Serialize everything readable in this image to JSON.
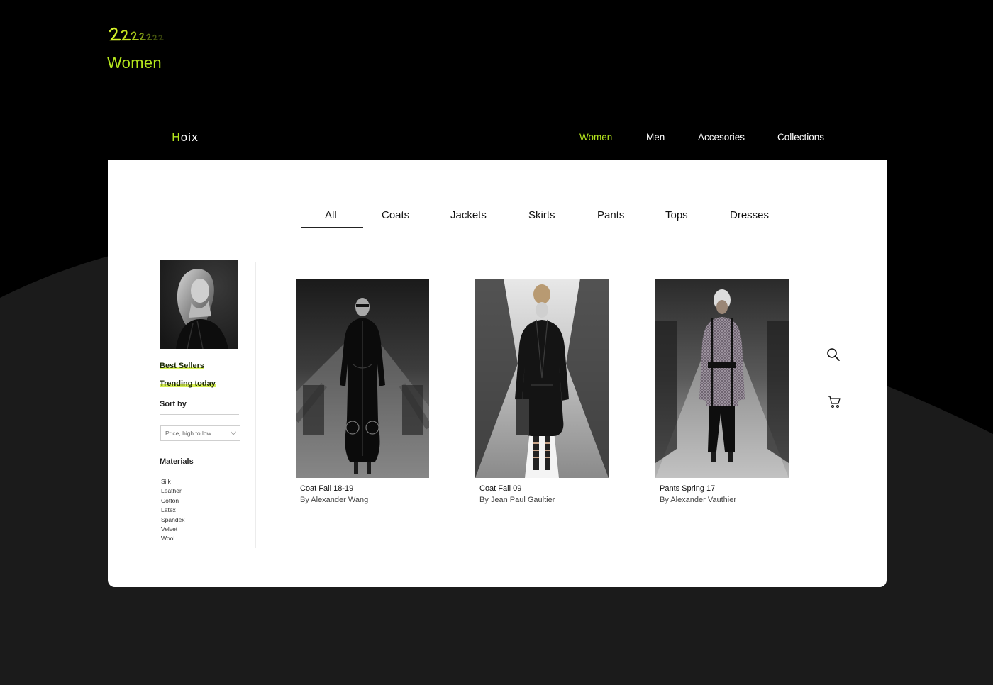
{
  "colors": {
    "accent": "#b5e61d",
    "background": "#000000",
    "wave": "#1b1b1b",
    "card": "#ffffff",
    "highlight": "#d8f055"
  },
  "header": {
    "page_title": "Women",
    "logo": {
      "icon": "scribble-logo-icon",
      "text": "2.2.2.2.2.2"
    }
  },
  "brand": {
    "first": "H",
    "rest": "oix"
  },
  "nav": {
    "items": [
      {
        "label": "Women",
        "active": true
      },
      {
        "label": "Men",
        "active": false
      },
      {
        "label": "Accesories",
        "active": false
      },
      {
        "label": "Collections",
        "active": false
      }
    ]
  },
  "tabs": {
    "items": [
      "All",
      "Coats",
      "Jackets",
      "Skirts",
      "Pants",
      "Tops",
      "Dresses"
    ],
    "active": "All"
  },
  "sidebar": {
    "featured_image": "portrait-photo",
    "links": [
      "Best Sellers",
      "Trending today"
    ],
    "sort": {
      "title": "Sort by",
      "selected": "Price, high to low"
    },
    "materials": {
      "title": "Materials",
      "items": [
        "Silk",
        "Leather",
        "Cotton",
        "Latex",
        "Spandex",
        "Velvet",
        "Wool"
      ]
    }
  },
  "products": [
    {
      "title": "Coat Fall 18-19",
      "designer": "By Alexander Wang",
      "image": "runway-black-croc-coat"
    },
    {
      "title": "Coat Fall 09",
      "designer": "By Jean Paul Gaultier",
      "image": "runway-leather-trench"
    },
    {
      "title": "Pants Spring 17",
      "designer": "By Alexander Vauthier",
      "image": "runway-tweed-coat"
    }
  ],
  "actions": {
    "search_icon": "search-icon",
    "cart_icon": "cart-icon"
  }
}
